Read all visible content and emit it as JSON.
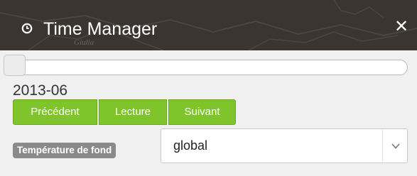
{
  "header": {
    "title": "Time Manager",
    "icon": "clock-icon",
    "close_icon": "close-icon",
    "background_map_text": "Giulia"
  },
  "slider": {
    "position_fraction": 0.0
  },
  "current_date": "2013-06",
  "buttons": {
    "previous": "Précédent",
    "play": "Lecture",
    "next": "Suivant"
  },
  "layer": {
    "label": "Température de fond",
    "selected": "global",
    "dropdown_icon": "chevron-down-icon"
  },
  "colors": {
    "header_bg": "#3a3530",
    "button_green": "#7ec42a",
    "label_grey": "#8a8a8a"
  }
}
